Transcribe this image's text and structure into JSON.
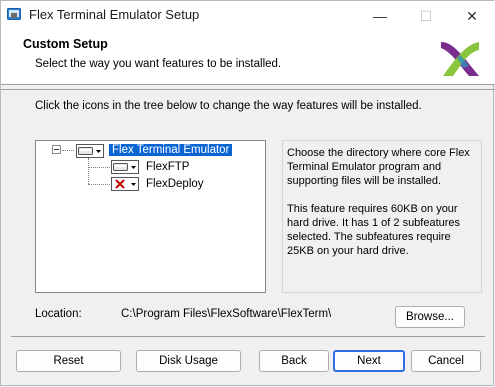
{
  "window": {
    "title": "Flex Terminal Emulator Setup",
    "controls": {
      "minimize": "—",
      "maximize": "☐",
      "close": "✕"
    }
  },
  "header": {
    "title": "Custom Setup",
    "subtitle": "Select the way you want features to be installed."
  },
  "instructions": "Click the icons in the tree below to change the way features will be installed.",
  "tree": {
    "expander": "⊟",
    "items": [
      {
        "label": "Flex Terminal Emulator",
        "state": "install",
        "selected": true
      },
      {
        "label": "FlexFTP",
        "state": "install",
        "selected": false
      },
      {
        "label": "FlexDeploy",
        "state": "not-available",
        "selected": false
      }
    ]
  },
  "description": {
    "para1": "Choose the directory where core Flex Terminal Emulator program and supporting files will be installed.",
    "para2": "This feature requires 60KB on your hard drive. It has 1 of 2 subfeatures selected. The subfeatures require 25KB on your hard drive."
  },
  "location": {
    "label": "Location:",
    "path": "C:\\Program Files\\FlexSoftware\\FlexTerm\\"
  },
  "buttons": {
    "browse": "Browse...",
    "reset": "Reset",
    "disk_usage": "Disk Usage",
    "back": "Back",
    "next": "Next",
    "cancel": "Cancel"
  },
  "colors": {
    "selection": "#0a64d2",
    "default_button_border": "#2e6ee6",
    "logo_purple": "#7b2d8e",
    "logo_green": "#8bc53f"
  }
}
